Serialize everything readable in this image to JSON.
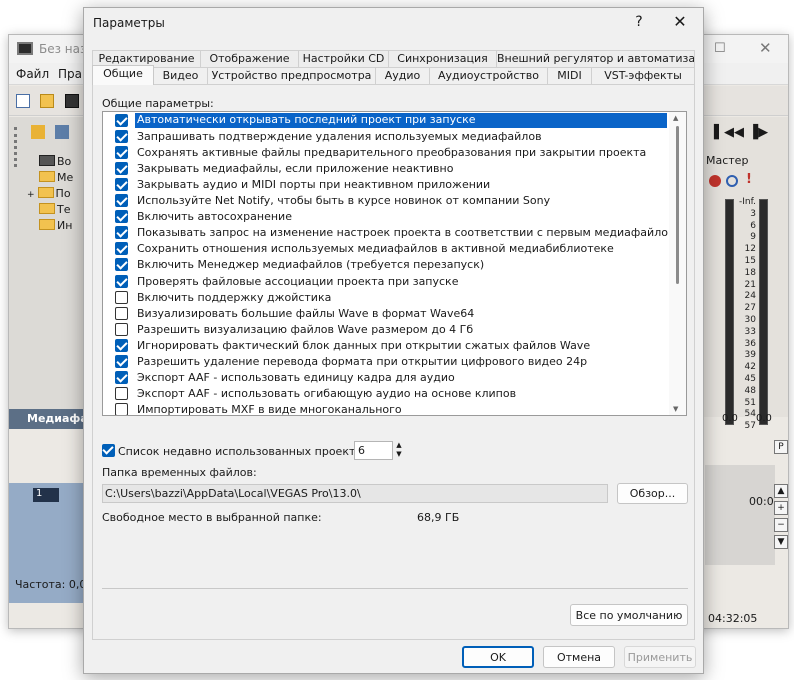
{
  "background_window": {
    "title": "Без наз",
    "menu": [
      "Файл",
      "Прав"
    ],
    "tree_items": [
      "Во",
      "Ме",
      "По",
      "Те",
      "Ин"
    ],
    "media_tab_label": "Медиафа",
    "track_number": "1",
    "freq_label": "Частота: 0,00",
    "mixer_title": "Мастер",
    "meter_scale": [
      "-Inf.",
      "3",
      "6",
      "9",
      "12",
      "15",
      "18",
      "21",
      "24",
      "27",
      "30",
      "33",
      "36",
      "39",
      "42",
      "45",
      "48",
      "51",
      "54",
      "57"
    ],
    "meter_values": [
      "0.0",
      "0.0"
    ],
    "timecode_label": "00:0",
    "time_display": "04:32:05"
  },
  "dialog": {
    "title": "Параметры",
    "help_glyph": "?",
    "close_glyph": "✕",
    "tabs_row1": [
      "Редактирование",
      "Отображение",
      "Настройки CD",
      "Синхронизация",
      "Внешний регулятор и автоматизац"
    ],
    "tabs_row2": [
      "Общие",
      "Видео",
      "Устройство предпросмотра",
      "Аудио",
      "Аудиоустройство",
      "MIDI",
      "VST-эффекты"
    ],
    "active_tab": "Общие",
    "group_label": "Общие параметры:",
    "options": [
      {
        "label": "Автоматически открывать последний проект при запуске",
        "checked": true,
        "selected": true
      },
      {
        "label": "Запрашивать подтверждение удаления используемых медиафайлов",
        "checked": true
      },
      {
        "label": "Сохранять активные файлы предварительного преобразования при закрытии проекта",
        "checked": true
      },
      {
        "label": "Закрывать медиафайлы, если приложение неактивно",
        "checked": true
      },
      {
        "label": "Закрывать аудио и MIDI порты при неактивном приложении",
        "checked": true
      },
      {
        "label": "Используйте Net Notify, чтобы быть в курсе новинок от компании Sony",
        "checked": true
      },
      {
        "label": "Включить автосохранение",
        "checked": true
      },
      {
        "label": "Показывать запрос на изменение настроек проекта в соответствии с первым медиафайлом, добавленн",
        "checked": true
      },
      {
        "label": "Сохранить отношения используемых медиафайлов в активной медиабиблиотеке",
        "checked": true
      },
      {
        "label": "Включить Менеджер медиафайлов (требуется перезапуск)",
        "checked": true
      },
      {
        "label": "Проверять файловые ассоциации проекта при запуске",
        "checked": true
      },
      {
        "label": "Включить поддержку джойстика",
        "checked": false
      },
      {
        "label": "Визуализировать большие файлы Wave в формат Wave64",
        "checked": false
      },
      {
        "label": "Разрешить визуализацию файлов Wave размером до 4 Гб",
        "checked": false
      },
      {
        "label": "Игнорировать фактический блок данных при открытии сжатых файлов Wave",
        "checked": true
      },
      {
        "label": "Разрешить удаление перевода формата при открытии цифрового видео 24p",
        "checked": true
      },
      {
        "label": "Экспорт AAF - использовать единицу кадра для аудио",
        "checked": true
      },
      {
        "label": "Экспорт AAF - использовать огибающую аудио на основе клипов",
        "checked": false
      },
      {
        "label": "Импортировать MXF в виде многоканального",
        "checked": false
      }
    ],
    "recent": {
      "label": "Список недавно использованных проектов:",
      "value": "6",
      "checked": true
    },
    "temp_folder": {
      "label": "Папка временных файлов:",
      "value": "C:\\Users\\bazzi\\AppData\\Local\\VEGAS Pro\\13.0\\",
      "browse": "Обзор..."
    },
    "free_space": {
      "label": "Свободное место в выбранной папке:",
      "value": "68,9 ГБ"
    },
    "defaults_button": "Все по умолчанию",
    "ok": "OK",
    "cancel": "Отмена",
    "apply": "Применить"
  }
}
